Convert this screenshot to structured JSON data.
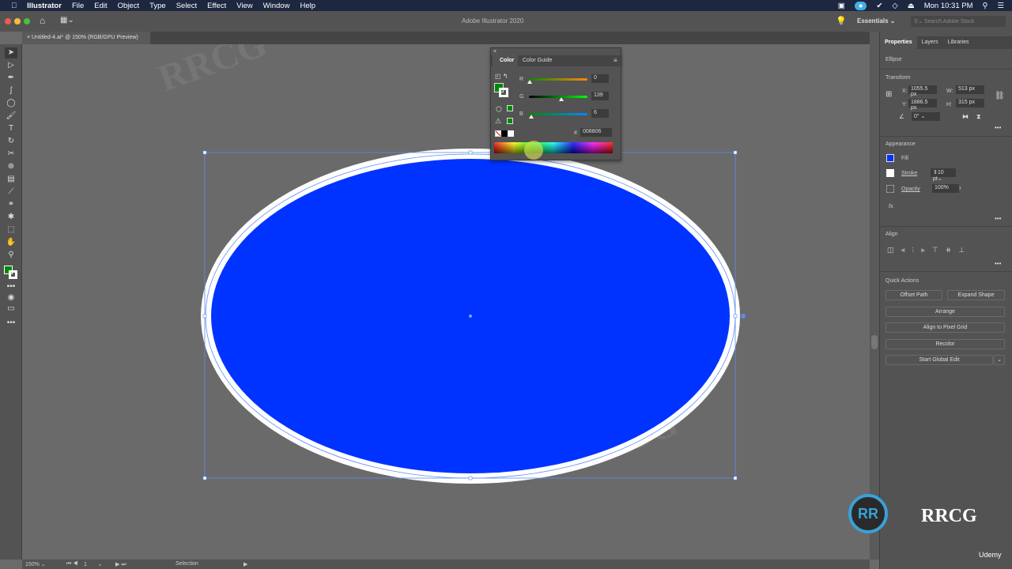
{
  "menubar": {
    "app": "Illustrator",
    "items": [
      "File",
      "Edit",
      "Object",
      "Type",
      "Select",
      "Effect",
      "View",
      "Window",
      "Help"
    ],
    "clock": "Mon 10:31 PM"
  },
  "appbar": {
    "title": "Adobe Illustrator 2020",
    "workspace": "Essentials",
    "search_placeholder": "Search Adobe Stock"
  },
  "document": {
    "tab": "Untitled-4.ai* @ 150% (RGB/GPU Preview)"
  },
  "color_panel": {
    "tabs": [
      "Color",
      "Color Guide"
    ],
    "r_label": "R",
    "g_label": "G",
    "b_label": "B",
    "r": "0",
    "g": "139",
    "b": "6",
    "r_frac": 0,
    "g_frac": 0.545,
    "b_frac": 0.024,
    "hex_label": "#",
    "hex": "008806"
  },
  "properties": {
    "tabs": [
      "Properties",
      "Layers",
      "Libraries"
    ],
    "object": "Ellipse",
    "transform": {
      "title": "Transform",
      "x_label": "X:",
      "x": "1055.5 px",
      "y_label": "Y:",
      "y": "1886.5 px",
      "w_label": "W:",
      "w": "513 px",
      "h_label": "H:",
      "h": "315 px",
      "angle": "0°"
    },
    "appearance": {
      "title": "Appearance",
      "fill": "Fill",
      "stroke": "Stroke",
      "stroke_weight": "10 pt",
      "opacity": "Opacity",
      "opacity_value": "100%",
      "fx": "fx."
    },
    "align": {
      "title": "Align"
    },
    "quick_actions": {
      "title": "Quick Actions",
      "offset": "Offset Path",
      "expand": "Expand Shape",
      "arrange": "Arrange",
      "pixel": "Align to Pixel Grid",
      "recolor": "Recolor",
      "global": "Start Global Edit"
    }
  },
  "statusbar": {
    "zoom": "150%",
    "artboard": "1",
    "tool": "Selection"
  },
  "colors": {
    "fill": "#0033ff",
    "stroke": "#ffffff",
    "color_fill": "#008806",
    "menubar": "#1d2740"
  },
  "watermark": "RRCG 人人素材",
  "brand": "Udemy"
}
